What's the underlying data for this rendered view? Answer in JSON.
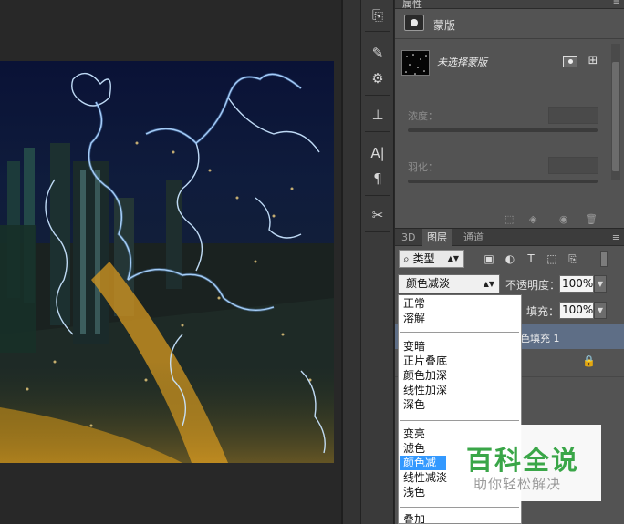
{
  "properties_panel": {
    "tab_label": "属性",
    "title": "蒙版",
    "mask_label": "未选择蒙版",
    "density_label": "浓度：",
    "feather_label": "羽化："
  },
  "icons": {
    "toolbar": [
      "history-icon",
      "brush-presets-icon",
      "adjustments-icon",
      "clone-source-icon",
      "character-icon",
      "paragraph-icon",
      "tools-icon"
    ],
    "props_footer": [
      "selection-icon",
      "apply-mask-icon",
      "visibility-icon",
      "delete-icon"
    ]
  },
  "layers_panel": {
    "tabs": [
      "3D",
      "图层",
      "通道"
    ],
    "active_tab": "图层",
    "filter_type": "类型",
    "blend_mode": "颜色减淡",
    "opacity_label": "不透明度：",
    "opacity_value": "100%",
    "fill_label": "填充：",
    "fill_value": "100%",
    "layer_name": "色填充 1"
  },
  "blend_dropdown": {
    "groups": [
      [
        "正常",
        "溶解"
      ],
      [
        "变暗",
        "正片叠底",
        "颜色加深",
        "线性加深",
        "深色"
      ],
      [
        "变亮",
        "滤色",
        "颜色减淡",
        "线性减淡",
        "浅色"
      ],
      [
        "叠加"
      ]
    ],
    "selected": "颜色减淡"
  },
  "watermark": {
    "title": "百科全说",
    "subtitle": "助你轻松解决"
  },
  "colors": {
    "panel_bg": "#535353",
    "selected_layer": "#5e6e86",
    "dropdown_highlight": "#3399ff",
    "watermark_green": "#3aa648"
  }
}
